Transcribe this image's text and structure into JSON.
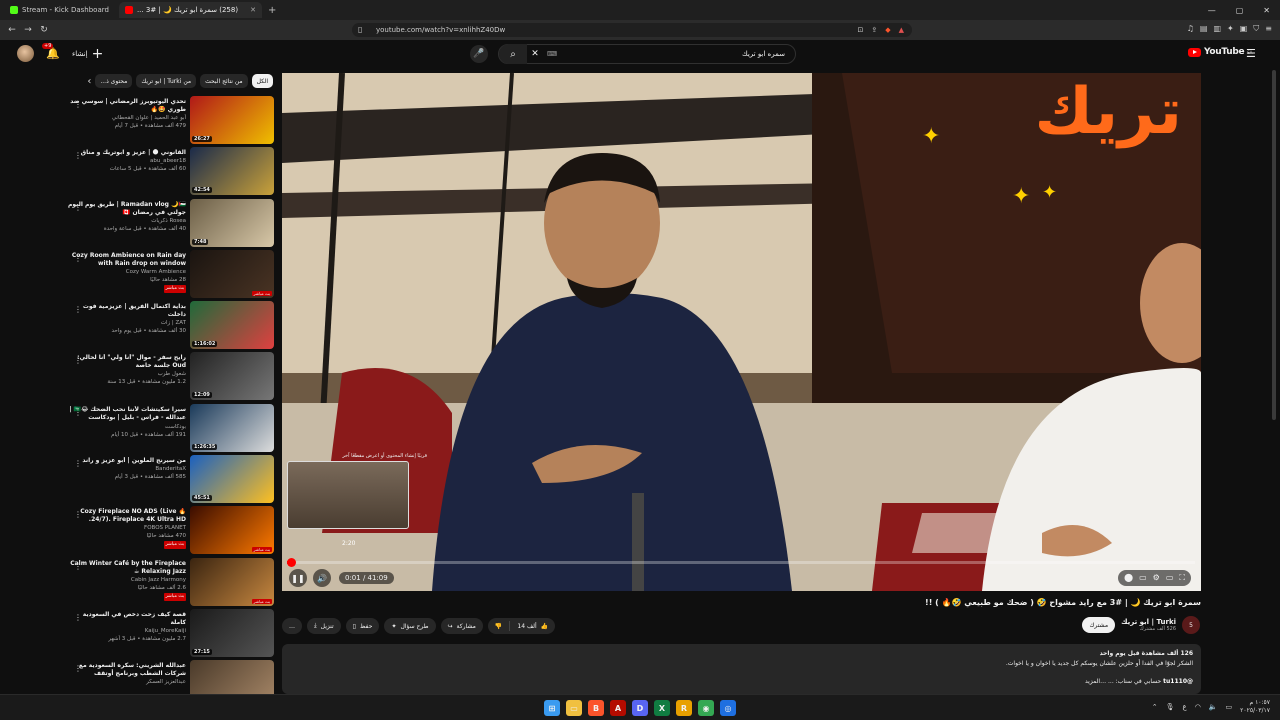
{
  "browser": {
    "tabs": [
      {
        "label": "Stream - Kick Dashboard",
        "color": "#53fc18"
      },
      {
        "label": "(258) سمرة ابو تريك 🌙 | #3 ...",
        "color": "#ff0000"
      }
    ],
    "new_tab": "+",
    "url": "youtube.com/watch?v=xnlihhZ40Dw",
    "window_controls": [
      "—",
      "▢",
      "✕"
    ]
  },
  "header": {
    "create_label": "إنشاء",
    "notifications_count": "+9",
    "search_query": "سمره ابو تريك",
    "search_kbd": "⌨",
    "logo_text": "YouTube",
    "logo_region": "SA"
  },
  "chips": [
    "الكل",
    "من نتائج البحث",
    "من Turki | ابو تريك",
    "محتوى ذ..."
  ],
  "recommendations": [
    {
      "title": "تحدي اليوتيوبرز الرمضاني | سوسي ضد طوري 🤩🔥",
      "channel": "أبو عبد الحميد | علوان القحطاني",
      "views": "479 ألف مشاهدة • قبل 7 أيام",
      "duration": "26:27",
      "c1": "#b01818",
      "c2": "#f0c000"
    },
    {
      "title": "القانوني 🌑 | عزيز و ابوتريك و مناق",
      "channel": "abu_abeer18",
      "views": "60 ألف مشاهدة • قبل 5 ساعات",
      "duration": "42:54",
      "c1": "#1a2a4a",
      "c2": "#caa23a"
    },
    {
      "title": "Ramadan vlog 🌙🇵🇸 | طريق يوم اليوم جولتي في رمضان 🇨🇦",
      "channel": "Rosea ذكريات",
      "views": "40 ألف مشاهدة • قبل ساعة واحدة",
      "duration": "7:48",
      "c1": "#6b5e46",
      "c2": "#d8c8a8"
    },
    {
      "title": "Cozy Room Ambience on Rain day with Rain drop on window",
      "channel": "Cozy Warm Ambience",
      "views": "28 مشاهد حاليًا",
      "duration": "",
      "live": "بث مباشر",
      "c1": "#1a1410",
      "c2": "#4a3424"
    },
    {
      "title": "بداية اكتمال الفريق | عزيزمية فوت داخلت",
      "channel": "ZAT | زات",
      "views": "30 ألف مشاهدة • قبل يوم واحد",
      "duration": "1:16:02",
      "c1": "#1f6a3a",
      "c2": "#e04040"
    },
    {
      "title": "رايح سفر - موال \"أنا ولي\" أنا لحالي: Oud جلسة خاصة",
      "channel": "شعول طرب",
      "views": "1.2 مليون مشاهدة • قبل 13 سنة",
      "duration": "12:09",
      "c1": "#222",
      "c2": "#777"
    },
    {
      "title": "سيرا سكيتشات لأننا نحب الضحك 😂🇸🇦 | عبدالله - فراس - بليل | بودكاست بسيري خبر",
      "channel": "بودكاست",
      "views": "191 ألف مشاهدة • قبل 10 أيام",
      "duration": "1:26:35",
      "c1": "#1a3a5a",
      "c2": "#ddd"
    },
    {
      "title": "من سيرنج الملوين | أبو عزيز و راند",
      "channel": "BanderitaX",
      "views": "585 ألف مشاهدة • قبل 3 أيام",
      "duration": "45:51",
      "c1": "#1a60c0",
      "c2": "#ffc020"
    },
    {
      "title": "🔥 Cozy Fireplace NO ADS (Live 24/7). Fireplace 4K Ultra HD.",
      "channel": "FOBOS PLANET",
      "views": "470 مشاهد حاليًا",
      "duration": "",
      "live": "بث مباشر",
      "c1": "#3a0c00",
      "c2": "#ff7a00"
    },
    {
      "title": "Calm Winter Café by the Fireplace ☕ Relaxing Jazz",
      "channel": "Cabin Jazz Harmony",
      "views": "2.6 ألف مشاهد حاليًا",
      "duration": "",
      "live": "بث مباشر",
      "c1": "#3a2410",
      "c2": "#c88840"
    },
    {
      "title": "قصة كيف زحت دخص في السعودية كاملة",
      "channel": "Kaiju_MoreKaiji",
      "views": "2.7 مليون مشاهدة • قبل 3 أشهر",
      "duration": "27:15",
      "c1": "#1a1a1a",
      "c2": "#555"
    },
    {
      "title": "عبدالله الشريني: سكره السعودية مع شركات الشطب وبرنامج أوتقف",
      "channel": "عبدالعزيز العسكر",
      "views": "",
      "duration": "",
      "c1": "#4a3a2a",
      "c2": "#a88868"
    }
  ],
  "player": {
    "current_time": "0:01",
    "duration": "41:09",
    "time_display": "0:01 / 41:09",
    "hover_time": "2:20",
    "preview_chapter": "قريبًا إنشاء المحتوى أو اعرض مقطعًا آخر",
    "progress": 0.004,
    "hover_fraction": 0.057
  },
  "video": {
    "title": "سمرة ابو تريك 🌙 | #3 مع رايد مشواح 🤣 ( ضحك مو طبيعي 🤣🔥 ) !!",
    "channel": "Turki | ابو تريك",
    "subscribers": "526 ألف مشترك",
    "subscribed_label": "مشترك",
    "likes": "14 ألف",
    "share": "مشاركة",
    "ask": "طرح سؤال",
    "save": "حفظ",
    "download": "تنزيل",
    "more": "…"
  },
  "description": {
    "stats": "126 ألف مشاهدة  قبل يوم واحد",
    "line": "الشكر لجوّا في الفدا أو حلزين علشان يوسكم كل جديد يا اخوان و يا اخوات.",
    "tag": "@tu1110",
    "more": "…المزيد",
    "extra": "حسابي في سناب: ..."
  },
  "taskbar": {
    "time": "١٠:٥٧ م",
    "date": "٢٠٢٥/٠٣/١٧",
    "icons": [
      {
        "name": "windows",
        "color": "#3a9bf0",
        "glyph": "⊞"
      },
      {
        "name": "explorer",
        "color": "#f0c040",
        "glyph": "▭"
      },
      {
        "name": "brave",
        "color": "#fb542b",
        "glyph": "B"
      },
      {
        "name": "acrobat",
        "color": "#b30b00",
        "glyph": "A"
      },
      {
        "name": "discord",
        "color": "#5865f2",
        "glyph": "D"
      },
      {
        "name": "excel",
        "color": "#107c41",
        "glyph": "X"
      },
      {
        "name": "files",
        "color": "#e8a000",
        "glyph": "R"
      },
      {
        "name": "chrome",
        "color": "#34a853",
        "glyph": "◉"
      },
      {
        "name": "other",
        "color": "#1e6fe0",
        "glyph": "◎"
      }
    ]
  }
}
